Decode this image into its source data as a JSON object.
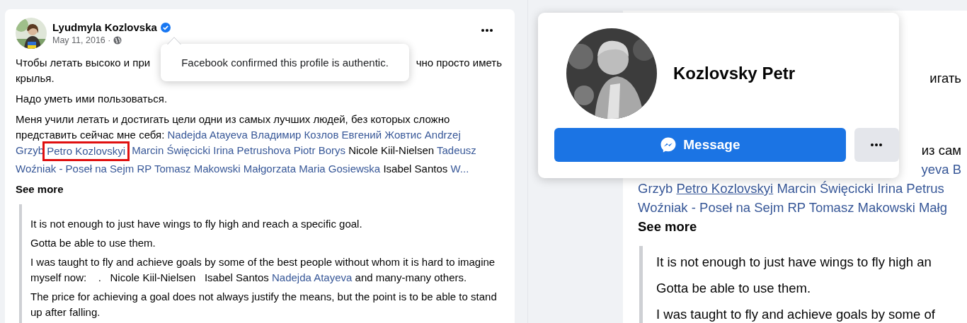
{
  "post": {
    "author": "Lyudmyla Kozlovska",
    "verified": true,
    "date": "May 11, 2016 ·",
    "paragraph_1": {
      "line_start": "Чтобы летать высоко и при",
      "line_end": "чно просто иметь",
      "rest": "крылья."
    },
    "paragraph_2": "Надо уметь ими пользоваться.",
    "paragraph_3": [
      {
        "segments": [
          {
            "kind": "text",
            "text": "Меня учили летать и достигать цели одни из самых лучших людей, без которых сложно"
          }
        ]
      },
      {
        "segments": [
          {
            "kind": "text",
            "text": "представить сейчас мне себя:"
          },
          {
            "kind": "link",
            "text": "Nadejda Atayeva"
          },
          {
            "kind": "link",
            "text": "Владимир Козлов"
          },
          {
            "kind": "link",
            "text": "Евгений Жовтис"
          },
          {
            "kind": "link",
            "text": "Andrzej"
          }
        ]
      },
      {
        "segments": [
          {
            "kind": "link",
            "text": "Grzyb"
          },
          {
            "kind": "framed_link",
            "text": "Petro Kozlovskyi"
          },
          {
            "kind": "link",
            "text": "Marcin Święcicki"
          },
          {
            "kind": "link",
            "text": "Irina Petrushova"
          },
          {
            "kind": "link",
            "text": "Piotr Borys"
          },
          {
            "kind": "text",
            "text": "Nicole Kiil-Nielsen"
          },
          {
            "kind": "link",
            "text": "Tadeusz"
          }
        ]
      },
      {
        "segments": [
          {
            "kind": "link",
            "text": "Woźniak - Poseł na Sejm RP"
          },
          {
            "kind": "link",
            "text": "Tomasz Makowski"
          },
          {
            "kind": "link",
            "text": "Małgorzata Maria Gosiewska"
          },
          {
            "kind": "text",
            "text": "Isabel Santos"
          },
          {
            "kind": "link",
            "text": "W..."
          }
        ]
      }
    ],
    "see_more": "See more",
    "translation": [
      {
        "segments": [
          {
            "kind": "text",
            "text": "It is not enough to just have wings to fly high and reach a specific goal."
          }
        ]
      },
      {
        "segments": [
          {
            "kind": "text",
            "text": "Gotta be able to use them."
          }
        ]
      },
      {
        "segments": [
          {
            "kind": "text",
            "text": "I was taught to fly and achieve goals by some of the best people without whom it is hard to imagine myself now:    .   Nicole Kiil-Nielsen   Isabel Santos"
          },
          {
            "kind": "link",
            "text": "Nadejda Atayeva"
          },
          {
            "kind": "text",
            "text": "and many-many others."
          }
        ]
      },
      {
        "segments": [
          {
            "kind": "text",
            "text": "The price for achieving a goal does not always justify the means, but the point is to be able to stand up after falling."
          }
        ]
      }
    ]
  },
  "tooltip": "Facebook confirmed this profile is authentic.",
  "zoomed_post": {
    "fragments": [
      {
        "segments": [
          {
            "kind": "text",
            "text": "игать"
          }
        ]
      },
      {
        "segments": [
          {
            "kind": "text",
            "text": "из сам"
          }
        ]
      },
      {
        "segments": [
          {
            "kind": "link",
            "text": "yeva"
          },
          {
            "kind": "link",
            "text": "В"
          }
        ]
      }
    ],
    "lines": [
      {
        "segments": [
          {
            "kind": "link",
            "text": "Grzyb"
          },
          {
            "kind": "hovered_link",
            "text": "Petro Kozlovskyi"
          },
          {
            "kind": "link",
            "text": "Marcin Święcicki"
          },
          {
            "kind": "link",
            "text": "Irina Petrus"
          }
        ]
      },
      {
        "segments": [
          {
            "kind": "link",
            "text": "Woźniak - Poseł na Sejm RP"
          },
          {
            "kind": "link",
            "text": "Tomasz Makowski"
          },
          {
            "kind": "link",
            "text": "Małg"
          }
        ]
      }
    ],
    "see_more": "See more",
    "translation": [
      "It is not enough to just have wings to fly high an",
      "Gotta be able to use them.",
      "I was taught to fly and achieve goals by some of"
    ]
  },
  "profile_card": {
    "name": "Kozlovsky Petr",
    "message_button": "Message"
  }
}
